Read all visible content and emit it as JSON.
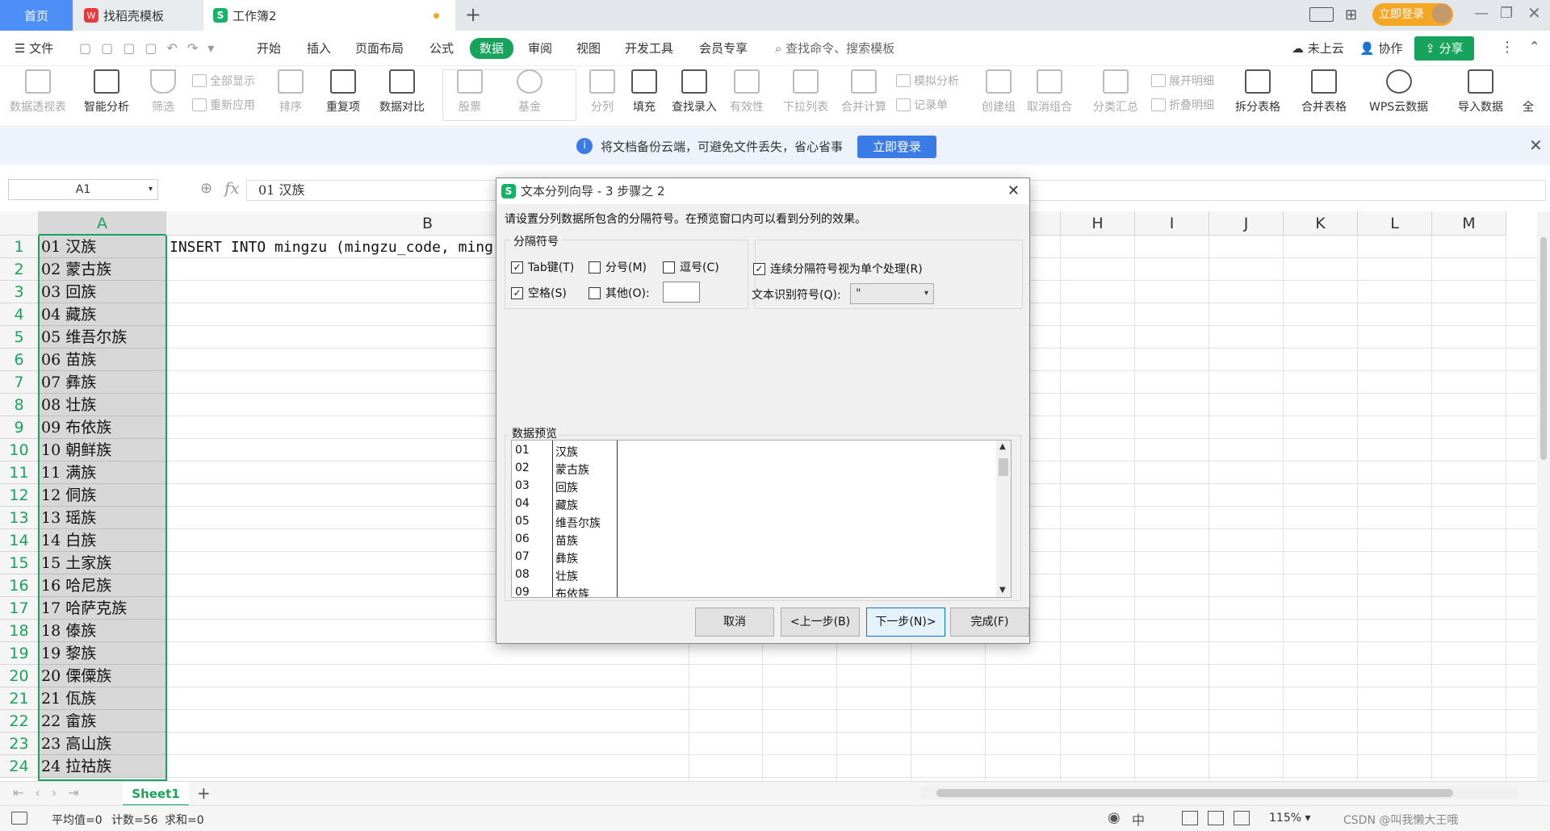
{
  "tabs": [
    {
      "label": "首页"
    },
    {
      "label": "找稻壳模板",
      "logo": "W"
    },
    {
      "label": "工作簿2",
      "logo": "S"
    }
  ],
  "top_right": {
    "login_button": "立即登录"
  },
  "menu": {
    "file": "文件",
    "items": [
      "开始",
      "插入",
      "页面布局",
      "公式",
      "数据",
      "审阅",
      "视图",
      "开发工具",
      "会员专享"
    ],
    "active": "数据",
    "search_placeholder": "查找命令、搜索模板",
    "cloud": "未上云",
    "collab": "协作",
    "share": "分享"
  },
  "ribbon": {
    "pivot": "数据透视表",
    "smart": "智能分析",
    "filter": "筛选",
    "show_all": "全部显示",
    "reapply": "重新应用",
    "sort": "排序",
    "dup": "重复项",
    "compare": "数据对比",
    "stock": "股票",
    "fund": "基金",
    "split": "分列",
    "fill": "填充",
    "lookup": "查找录入",
    "valid": "有效性",
    "dropdown": "下拉列表",
    "merge_calc": "合并计算",
    "simulate": "模拟分析",
    "record": "记录单",
    "group": "创建组",
    "ungroup": "取消组合",
    "subtotal": "分类汇总",
    "expand": "展开明细",
    "collapse": "折叠明细",
    "split_table": "拆分表格",
    "merge_table": "合并表格",
    "wps_cloud": "WPS云数据",
    "import": "导入数据",
    "more": "全"
  },
  "banner": {
    "text": "将文档备份云端，可避免文件丢失，省心省事",
    "button": "立即登录"
  },
  "formula": {
    "cell_ref": "A1",
    "fx": "fx",
    "content": "01 汉族"
  },
  "columns": [
    "A",
    "B",
    "H",
    "I",
    "J",
    "K",
    "L",
    "M"
  ],
  "row_numbers": [
    "1",
    "2",
    "3",
    "4",
    "5",
    "6",
    "7",
    "8",
    "9",
    "10",
    "11",
    "12",
    "13",
    "14",
    "15",
    "16",
    "17",
    "18",
    "19",
    "20",
    "21",
    "22",
    "23",
    "24"
  ],
  "cells_A": [
    "01 汉族",
    "02 蒙古族",
    "03 回族",
    "04 藏族",
    "05 维吾尔族",
    "06 苗族",
    "07 彝族",
    "08 壮族",
    "09 布依族",
    "10 朝鲜族",
    "11 满族",
    "12 侗族",
    "13 瑶族",
    "14 白族",
    "15 土家族",
    "16 哈尼族",
    "17 哈萨克族",
    "18 傣族",
    "19 黎族",
    "20 傈僳族",
    "21 佤族",
    "22 畲族",
    "23 高山族",
    "24 拉祜族"
  ],
  "cell_B1": "INSERT INTO mingzu (mingzu_code, ming",
  "sheet": {
    "name": "Sheet1"
  },
  "status": {
    "avg": "平均值=0",
    "count": "计数=56",
    "sum": "求和=0",
    "zoom": "115%",
    "watermark": "CSDN @叫我懒大王哦"
  },
  "dialog": {
    "title": "文本分列向导 - 3 步骤之 2",
    "instruction": "请设置分列数据所包含的分隔符号。在预览窗口内可以看到分列的效果。",
    "group_label": "分隔符号",
    "tab": "Tab键(T)",
    "semicolon": "分号(M)",
    "comma": "逗号(C)",
    "space": "空格(S)",
    "other": "其他(O):",
    "consecutive": "连续分隔符号视为单个处理(R)",
    "qualifier_label": "文本识别符号(Q):",
    "qualifier_value": "\"",
    "preview_label": "数据预览",
    "preview_codes": [
      "01",
      "02",
      "03",
      "04",
      "05",
      "06",
      "07",
      "08",
      "09"
    ],
    "preview_names": [
      "汉族",
      "蒙古族",
      "回族",
      "藏族",
      "维吾尔族",
      "苗族",
      "彝族",
      "壮族",
      "布依族"
    ],
    "cancel": "取消",
    "back": "<上一步(B)",
    "next": "下一步(N)>",
    "finish": "完成(F)"
  }
}
